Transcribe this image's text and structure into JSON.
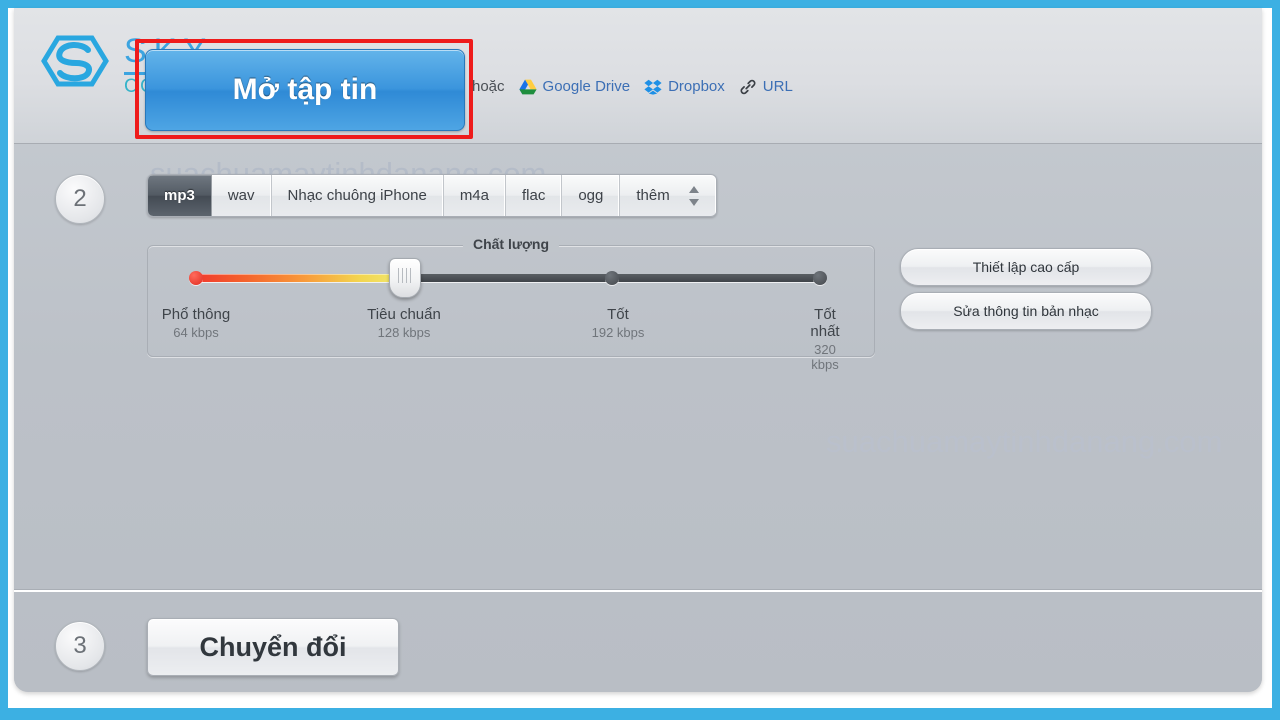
{
  "frame": {
    "border_color": "#3cb0e3",
    "mat_color": "#ffffff"
  },
  "header": {
    "open_file_button": "Mở tập tin",
    "or_label": "hoặc",
    "sources": [
      {
        "label": "Google Drive",
        "icon": "google-drive-icon"
      },
      {
        "label": "Dropbox",
        "icon": "dropbox-icon"
      },
      {
        "label": "URL",
        "icon": "link-icon"
      }
    ],
    "highlight_color": "#ee1b1b"
  },
  "logo": {
    "name_top": "SKY",
    "name_bottom": "COMPUTER",
    "mark": "sky-hexagon-s-logo"
  },
  "steps": {
    "two": "2",
    "three": "3"
  },
  "format_tabs": {
    "items": [
      {
        "label": "mp3",
        "selected": true
      },
      {
        "label": "wav",
        "selected": false
      },
      {
        "label": "Nhạc chuông iPhone",
        "selected": false
      },
      {
        "label": "m4a",
        "selected": false
      },
      {
        "label": "flac",
        "selected": false
      },
      {
        "label": "ogg",
        "selected": false
      },
      {
        "label": "thêm",
        "selected": false,
        "has_spinner": true
      }
    ]
  },
  "quality": {
    "legend": "Chất lượng",
    "selected_index": 1,
    "stops": [
      {
        "name": "Phổ thông",
        "rate": "64 kbps"
      },
      {
        "name": "Tiêu chuẩn",
        "rate": "128 kbps"
      },
      {
        "name": "Tốt",
        "rate": "192 kbps"
      },
      {
        "name": "Tốt nhất",
        "rate": "320 kbps"
      }
    ]
  },
  "side_buttons": {
    "advanced": "Thiết lập cao cấp",
    "tags": "Sửa thông tin bản nhạc"
  },
  "convert_button": "Chuyển đổi",
  "watermark": {
    "top": "suachuamaytinhdanang.com",
    "middle": "suachuamaytinhdanang.com"
  },
  "chart_data": {
    "type": "slider",
    "title": "Chất lượng",
    "categories": [
      "Phổ thông",
      "Tiêu chuẩn",
      "Tốt",
      "Tốt nhất"
    ],
    "values": [
      64,
      128,
      192,
      320
    ],
    "ylabel": "kbps",
    "selected": "Tiêu chuẩn",
    "selected_value": 128
  }
}
